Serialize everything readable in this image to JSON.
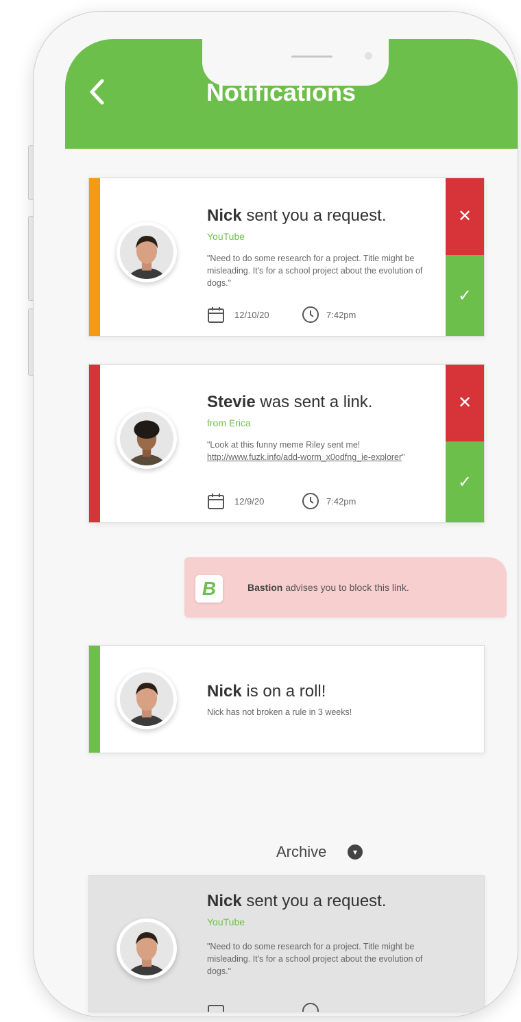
{
  "header": {
    "title": "Notifications",
    "back_icon": "chevron-left-icon"
  },
  "notifications": [
    {
      "name": "Nick",
      "action": "sent you a request.",
      "sub": "YouTube",
      "message": "\"Need to do some research for a project. Title might be misleading. It's for a school project about the evolution of dogs.\"",
      "date": "12/10/20",
      "time": "7:42pm",
      "stripe_color": "#f39c12"
    },
    {
      "name": "Stevie",
      "action": "was sent a link.",
      "sub": "from Erica",
      "message_text": "\"Look at this funny meme Riley sent me! ",
      "message_link": "http://www.fuzk.info/add-worm_x0odfng_ie-explorer",
      "message_end": "\"",
      "date": "12/9/20",
      "time": "7:42pm",
      "stripe_color": "#d7343a"
    },
    {
      "name": "Nick",
      "action": "is on a roll!",
      "message": "Nick has not broken a rule in 3 weeks!",
      "stripe_color": "#6dbf4b"
    }
  ],
  "advice": {
    "logo": "B",
    "name": "Bastion",
    "text": " advises you to block this link."
  },
  "archive": {
    "label": "Archive",
    "item": {
      "name": "Nick",
      "action": "sent you a request.",
      "sub": "YouTube",
      "message": "\"Need to do some research for a project. Title might be misleading. It's for a school project about the evolution of dogs.\""
    }
  },
  "buttons": {
    "deny": "✕",
    "approve": "✓"
  }
}
